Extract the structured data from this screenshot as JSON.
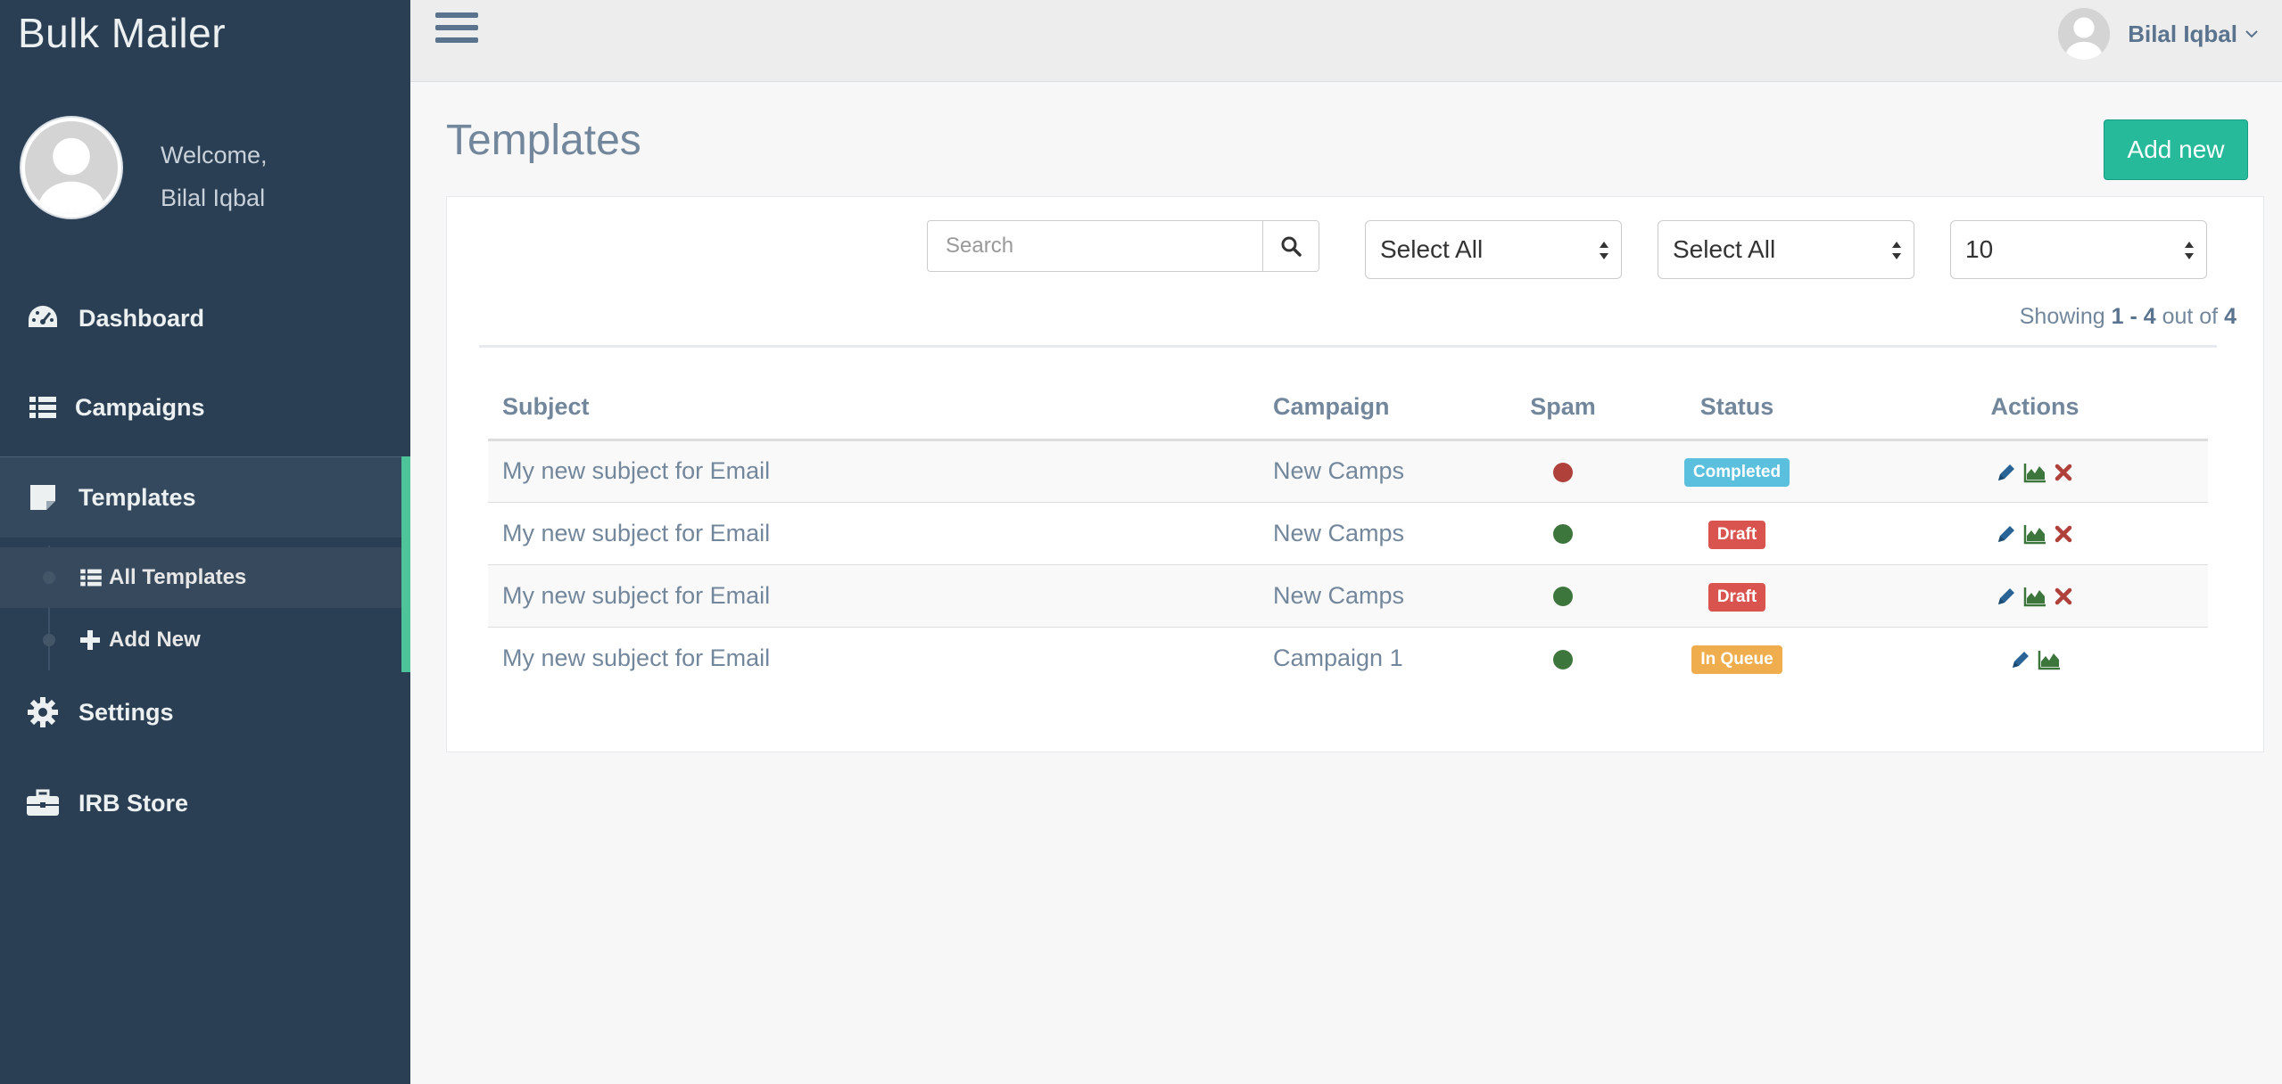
{
  "brand": "Bulk Mailer",
  "profile": {
    "welcome": "Welcome,",
    "name": "Bilal Iqbal"
  },
  "sidebar": {
    "items": [
      {
        "label": "Dashboard",
        "icon": "dashboard-icon"
      },
      {
        "label": "Campaigns",
        "icon": "list-icon"
      },
      {
        "label": "Templates",
        "icon": "note-icon"
      },
      {
        "label": "Settings",
        "icon": "gear-icon"
      },
      {
        "label": "IRB Store",
        "icon": "briefcase-icon"
      }
    ],
    "sub_items": [
      {
        "label": "All Templates",
        "icon": "list-icon"
      },
      {
        "label": "Add New",
        "icon": "plus-icon"
      }
    ]
  },
  "topbar": {
    "user_name": "Bilal Iqbal"
  },
  "page": {
    "title": "Templates",
    "add_button": "Add new"
  },
  "filters": {
    "search_placeholder": "Search",
    "select1": "Select All",
    "select2": "Select All",
    "page_size": "10"
  },
  "showing": {
    "prefix": "Showing",
    "range": "1 - 4",
    "middle": "out of",
    "total": "4"
  },
  "table": {
    "headers": {
      "subject": "Subject",
      "campaign": "Campaign",
      "spam": "Spam",
      "status": "Status",
      "actions": "Actions"
    },
    "rows": [
      {
        "subject": "My new subject for Email",
        "campaign": "New Camps",
        "status": "Completed",
        "status_color": "#5bc0de",
        "spam_color": "#b0403a"
      },
      {
        "subject": "My new subject for Email",
        "campaign": "New Camps",
        "status": "Draft",
        "status_color": "#d9534f",
        "spam_color": "#3c763d"
      },
      {
        "subject": "My new subject for Email",
        "campaign": "New Camps",
        "status": "Draft",
        "status_color": "#d9534f",
        "spam_color": "#3c763d"
      },
      {
        "subject": "My new subject for Email",
        "campaign": "Campaign 1",
        "status": "In Queue",
        "status_color": "#f0ad4e",
        "spam_color": "#3c763d"
      }
    ]
  },
  "colors": {
    "sidebar": "#2a3f54",
    "accent": "#26b99a",
    "text": "#73879c"
  }
}
